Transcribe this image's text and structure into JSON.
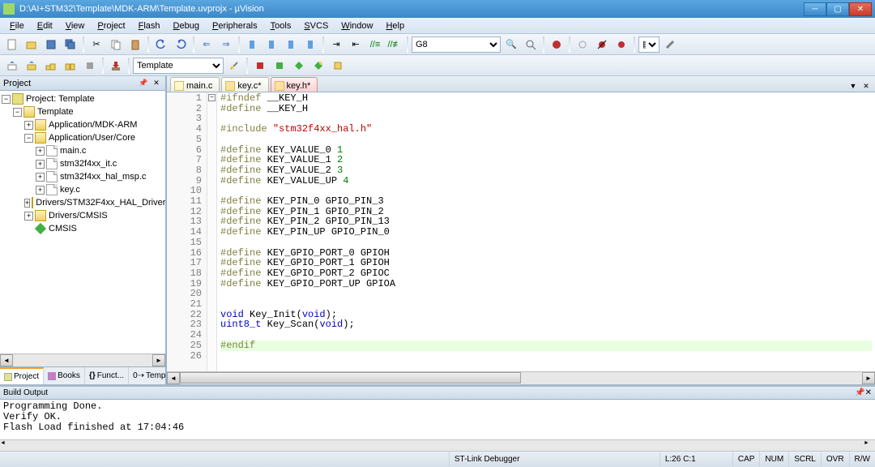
{
  "title": "D:\\AI+STM32\\Template\\MDK-ARM\\Template.uvprojx - µVision",
  "menu": [
    "File",
    "Edit",
    "View",
    "Project",
    "Flash",
    "Debug",
    "Peripherals",
    "Tools",
    "SVCS",
    "Window",
    "Help"
  ],
  "toolbar2": {
    "target": "Template"
  },
  "toolbar1": {
    "find": "G8"
  },
  "project_panel": {
    "title": "Project",
    "root": "Project: Template",
    "target": "Template",
    "groups": [
      {
        "name": "Application/MDK-ARM",
        "expanded": false
      },
      {
        "name": "Application/User/Core",
        "expanded": true,
        "files": [
          "main.c",
          "stm32f4xx_it.c",
          "stm32f4xx_hal_msp.c",
          "key.c"
        ]
      },
      {
        "name": "Drivers/STM32F4xx_HAL_Driver",
        "expanded": false
      },
      {
        "name": "Drivers/CMSIS",
        "expanded": false
      }
    ],
    "cmsis": "CMSIS",
    "bottom_tabs": [
      "Project",
      "Books",
      "Funct...",
      "Templ..."
    ]
  },
  "editor": {
    "tabs": [
      {
        "name": "main.c",
        "modified": false,
        "active": false
      },
      {
        "name": "key.c*",
        "modified": true,
        "active": false
      },
      {
        "name": "key.h*",
        "modified": true,
        "active": true
      }
    ],
    "lines": [
      "#ifndef __KEY_H",
      "#define __KEY_H",
      "",
      "#include \"stm32f4xx_hal.h\"",
      "",
      "#define KEY_VALUE_0 1",
      "#define KEY_VALUE_1 2",
      "#define KEY_VALUE_2 3",
      "#define KEY_VALUE_UP 4",
      "",
      "#define KEY_PIN_0 GPIO_PIN_3",
      "#define KEY_PIN_1 GPIO_PIN_2",
      "#define KEY_PIN_2 GPIO_PIN_13",
      "#define KEY_PIN_UP GPIO_PIN_0",
      "",
      "#define KEY_GPIO_PORT_0 GPIOH",
      "#define KEY_GPIO_PORT_1 GPIOH",
      "#define KEY_GPIO_PORT_2 GPIOC",
      "#define KEY_GPIO_PORT_UP GPIOA",
      "",
      "",
      "void Key_Init(void);",
      "uint8_t Key_Scan(void);",
      "",
      "#endif",
      ""
    ],
    "line_count": 26
  },
  "build": {
    "title": "Build Output",
    "lines": [
      "Programming Done.",
      "Verify OK.",
      "Flash Load finished at 17:04:46"
    ]
  },
  "status": {
    "debugger": "ST-Link Debugger",
    "pos": "L:26 C:1",
    "flags": [
      "CAP",
      "NUM",
      "SCRL",
      "OVR",
      "R/W"
    ]
  }
}
